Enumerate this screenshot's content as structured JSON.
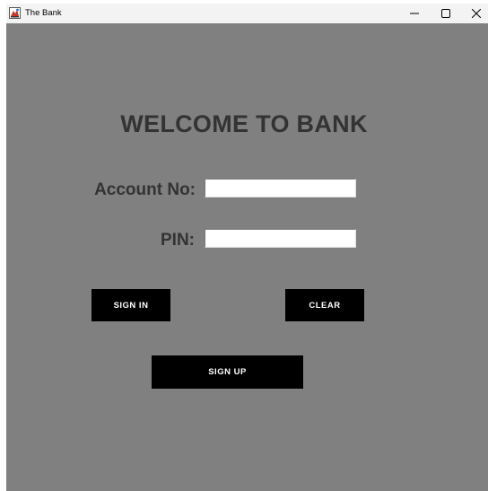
{
  "window": {
    "title": "The Bank",
    "icon": "java-app-icon",
    "controls": {
      "minimize_icon": "minimize-icon",
      "maximize_icon": "maximize-icon",
      "close_icon": "close-icon"
    }
  },
  "login": {
    "heading": "WELCOME TO BANK",
    "account_label": "Account No:",
    "account_value": "",
    "pin_label": "PIN:",
    "pin_value": "",
    "sign_in_label": "SIGN IN",
    "clear_label": "CLEAR",
    "sign_up_label": "SIGN UP"
  },
  "colors": {
    "background": "#808080",
    "text": "#333333",
    "button_bg": "#000000",
    "button_text": "#ffffff"
  }
}
